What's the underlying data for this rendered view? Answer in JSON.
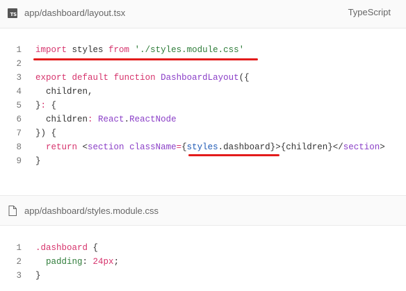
{
  "files": [
    {
      "path": "app/dashboard/layout.tsx",
      "icon": "ts-icon",
      "badge": "TS",
      "language": "TypeScript",
      "lines": [
        {
          "n": "1",
          "tokens": [
            [
              "import",
              "kw"
            ],
            [
              " styles ",
              "pl"
            ],
            [
              "from",
              "kw"
            ],
            [
              " ",
              "pl"
            ],
            [
              "'./styles.module.css'",
              "str"
            ]
          ]
        },
        {
          "n": "2",
          "tokens": []
        },
        {
          "n": "3",
          "tokens": [
            [
              "export",
              "kw"
            ],
            [
              " ",
              "pl"
            ],
            [
              "default",
              "kw"
            ],
            [
              " ",
              "pl"
            ],
            [
              "function",
              "kw"
            ],
            [
              " ",
              "pl"
            ],
            [
              "DashboardLayout",
              "ty"
            ],
            [
              "({",
              "pl"
            ]
          ]
        },
        {
          "n": "4",
          "tokens": [
            [
              "  children,",
              "pl"
            ]
          ]
        },
        {
          "n": "5",
          "tokens": [
            [
              "}",
              "pl"
            ],
            [
              ":",
              "kw"
            ],
            [
              " {",
              "pl"
            ]
          ]
        },
        {
          "n": "6",
          "tokens": [
            [
              "  children",
              "pl"
            ],
            [
              ":",
              "kw"
            ],
            [
              " ",
              "pl"
            ],
            [
              "React",
              "ty"
            ],
            [
              ".",
              "pl"
            ],
            [
              "ReactNode",
              "ty"
            ]
          ]
        },
        {
          "n": "7",
          "tokens": [
            [
              "}) {",
              "pl"
            ]
          ]
        },
        {
          "n": "8",
          "tokens": [
            [
              "  ",
              "pl"
            ],
            [
              "return",
              "kw"
            ],
            [
              " <",
              "pl"
            ],
            [
              "section",
              "tag"
            ],
            [
              " ",
              "pl"
            ],
            [
              "className",
              "attr"
            ],
            [
              "=",
              "kw"
            ],
            [
              "{",
              "pl"
            ],
            [
              "styles",
              "var"
            ],
            [
              ".",
              "pl"
            ],
            [
              "dashboard",
              "pl"
            ],
            [
              "}",
              "pl"
            ],
            [
              ">{children}</",
              "pl"
            ],
            [
              "section",
              "tag"
            ],
            [
              ">",
              "pl"
            ]
          ]
        },
        {
          "n": "9",
          "tokens": [
            [
              "}",
              "pl"
            ]
          ]
        }
      ]
    },
    {
      "path": "app/dashboard/styles.module.css",
      "icon": "file-icon",
      "lines": [
        {
          "n": "1",
          "tokens": [
            [
              ".dashboard",
              "kw"
            ],
            [
              " {",
              "pl"
            ]
          ]
        },
        {
          "n": "2",
          "tokens": [
            [
              "  ",
              "pl"
            ],
            [
              "padding",
              "prop"
            ],
            [
              ": ",
              "pl"
            ],
            [
              "24px",
              "kw"
            ],
            [
              ";",
              "pl"
            ]
          ]
        },
        {
          "n": "3",
          "tokens": [
            [
              "}",
              "pl"
            ]
          ]
        }
      ]
    }
  ],
  "colors": {
    "keyword": "#d6336c",
    "string": "#2f7d3a",
    "type": "#8a3ec7",
    "highlight_underline": "#e31b1b"
  }
}
